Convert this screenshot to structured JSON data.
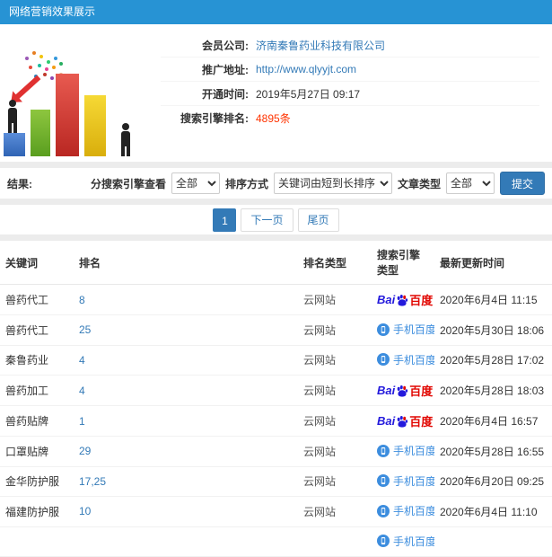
{
  "header": {
    "title": "网络营销效果展示"
  },
  "info": {
    "fields": [
      {
        "label": "会员公司:",
        "value": "济南秦鲁药业科技有限公司"
      },
      {
        "label": "推广地址:",
        "value": "http://www.qlyyjt.com"
      },
      {
        "label": "开通时间:",
        "value": "2019年5月27日 09:17"
      },
      {
        "label": "搜索引擎排名:",
        "value": "4895条"
      }
    ]
  },
  "filters": {
    "result_label": "结果:",
    "engine_label": "分搜索引擎查看",
    "engine_value": "全部",
    "sort_label": "排序方式",
    "sort_value": "关键词由短到长排序",
    "article_label": "文章类型",
    "article_value": "全部",
    "submit_label": "提交"
  },
  "pagination": {
    "current": "1",
    "next": "下一页",
    "last": "尾页"
  },
  "table": {
    "headers": [
      "关键词",
      "排名",
      "排名类型",
      "搜索引擎类型",
      "最新更新时间"
    ],
    "rows": [
      {
        "keyword": "兽药代工",
        "rank": "8",
        "rank_type": "云网站",
        "engine": "baidu",
        "updated": "2020年6月4日 11:15"
      },
      {
        "keyword": "兽药代工",
        "rank": "25",
        "rank_type": "云网站",
        "engine": "mobile",
        "updated": "2020年5月30日 18:06"
      },
      {
        "keyword": "秦鲁药业",
        "rank": "4",
        "rank_type": "云网站",
        "engine": "mobile",
        "updated": "2020年5月28日 17:02"
      },
      {
        "keyword": "兽药加工",
        "rank": "4",
        "rank_type": "云网站",
        "engine": "baidu",
        "updated": "2020年5月28日 18:03"
      },
      {
        "keyword": "兽药贴牌",
        "rank": "1",
        "rank_type": "云网站",
        "engine": "baidu",
        "updated": "2020年6月4日 16:57"
      },
      {
        "keyword": "口罩贴牌",
        "rank": "29",
        "rank_type": "云网站",
        "engine": "mobile",
        "updated": "2020年5月28日 16:55"
      },
      {
        "keyword": "金华防护服",
        "rank": "17,25",
        "rank_type": "云网站",
        "engine": "mobile",
        "updated": "2020年6月20日 09:25"
      },
      {
        "keyword": "福建防护服",
        "rank": "10",
        "rank_type": "云网站",
        "engine": "mobile",
        "updated": "2020年6月4日 11:10"
      },
      {
        "keyword": "",
        "rank": "",
        "rank_type": "",
        "engine": "mobile",
        "updated": ""
      }
    ]
  },
  "engines": {
    "baidu": {
      "bai": "Bai",
      "du": "百度"
    },
    "mobile": {
      "label": "手机百度"
    }
  },
  "colors": {
    "header_bg": "#2793d4",
    "link": "#337ab7",
    "rank_highlight": "#ff3300",
    "baidu_blue": "#2319dc",
    "baidu_red": "#e10601",
    "mobile_blue": "#3c8dde"
  }
}
